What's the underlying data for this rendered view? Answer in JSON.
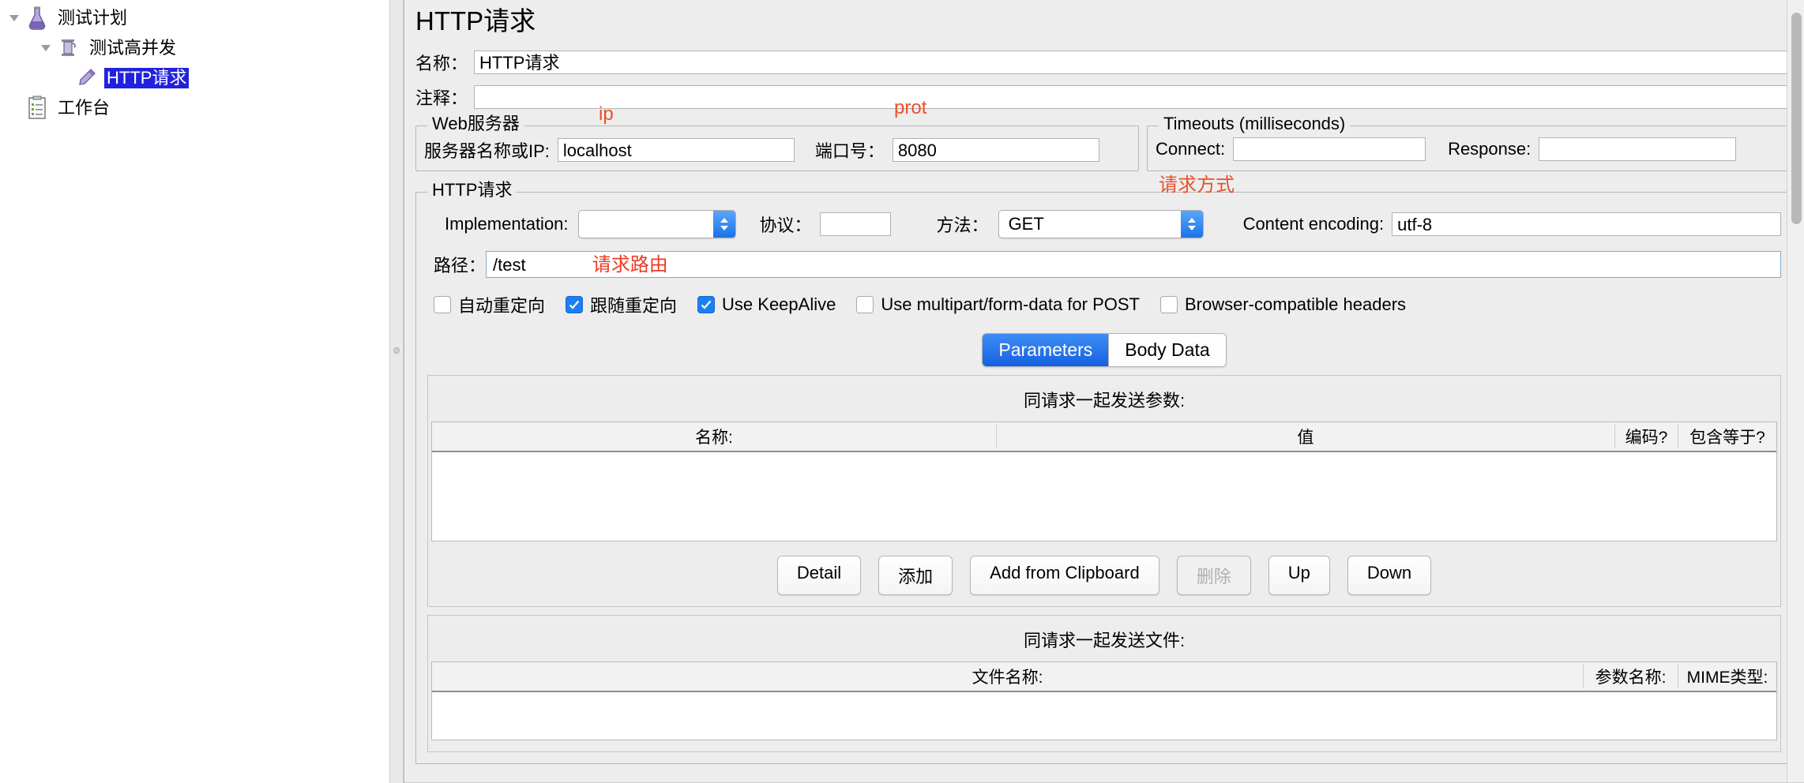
{
  "tree": {
    "items": [
      {
        "label": "测试计划",
        "icon": "flask-icon",
        "level": 1,
        "expanded": true,
        "selected": false
      },
      {
        "label": "测试高并发",
        "icon": "thread-group-icon",
        "level": 2,
        "expanded": true,
        "selected": false
      },
      {
        "label": "HTTP请求",
        "icon": "sampler-icon",
        "level": 3,
        "expanded": false,
        "selected": true
      },
      {
        "label": "工作台",
        "icon": "workbench-icon",
        "level": 1,
        "expanded": false,
        "selected": false
      }
    ]
  },
  "page": {
    "title": "HTTP请求",
    "name_label": "名称：",
    "name_value": "HTTP请求",
    "comment_label": "注释：",
    "comment_value": ""
  },
  "web_server": {
    "legend": "Web服务器",
    "host_label": "服务器名称或IP:",
    "host_value": "localhost",
    "port_label": "端口号：",
    "port_value": "8080",
    "annotation_ip": "ip",
    "annotation_port": "prot"
  },
  "timeouts": {
    "legend": "Timeouts (milliseconds)",
    "connect_label": "Connect:",
    "connect_value": "",
    "response_label": "Response:",
    "response_value": ""
  },
  "http_request": {
    "legend": "HTTP请求",
    "implementation_label": "Implementation:",
    "implementation_value": "",
    "protocol_label": "协议：",
    "protocol_value": "",
    "method_label": "方法：",
    "method_value": "GET",
    "method_annotation": "请求方式",
    "encoding_label": "Content encoding:",
    "encoding_value": "utf-8",
    "path_label": "路径：",
    "path_value": "/test",
    "path_annotation": "请求路由",
    "checkboxes": [
      {
        "label": "自动重定向",
        "checked": false
      },
      {
        "label": "跟随重定向",
        "checked": true
      },
      {
        "label": "Use KeepAlive",
        "checked": true
      },
      {
        "label": "Use multipart/form-data for POST",
        "checked": false
      },
      {
        "label": "Browser-compatible headers",
        "checked": false
      }
    ]
  },
  "tabs": [
    {
      "label": "Parameters",
      "active": true
    },
    {
      "label": "Body Data",
      "active": false
    }
  ],
  "parameters": {
    "title": "同请求一起发送参数:",
    "columns": [
      "名称:",
      "值",
      "编码?",
      "包含等于?"
    ],
    "rows": [],
    "buttons": [
      {
        "label": "Detail",
        "enabled": true
      },
      {
        "label": "添加",
        "enabled": true
      },
      {
        "label": "Add from Clipboard",
        "enabled": true
      },
      {
        "label": "删除",
        "enabled": false
      },
      {
        "label": "Up",
        "enabled": true
      },
      {
        "label": "Down",
        "enabled": true
      }
    ]
  },
  "files": {
    "title": "同请求一起发送文件:",
    "columns": [
      "文件名称:",
      "参数名称:",
      "MIME类型:"
    ],
    "rows": []
  },
  "colors": {
    "accent_blue": "#1d7ef3",
    "selection_blue": "#2222dd",
    "annotation_red": "#e8512a",
    "panel_bg": "#ededed"
  }
}
